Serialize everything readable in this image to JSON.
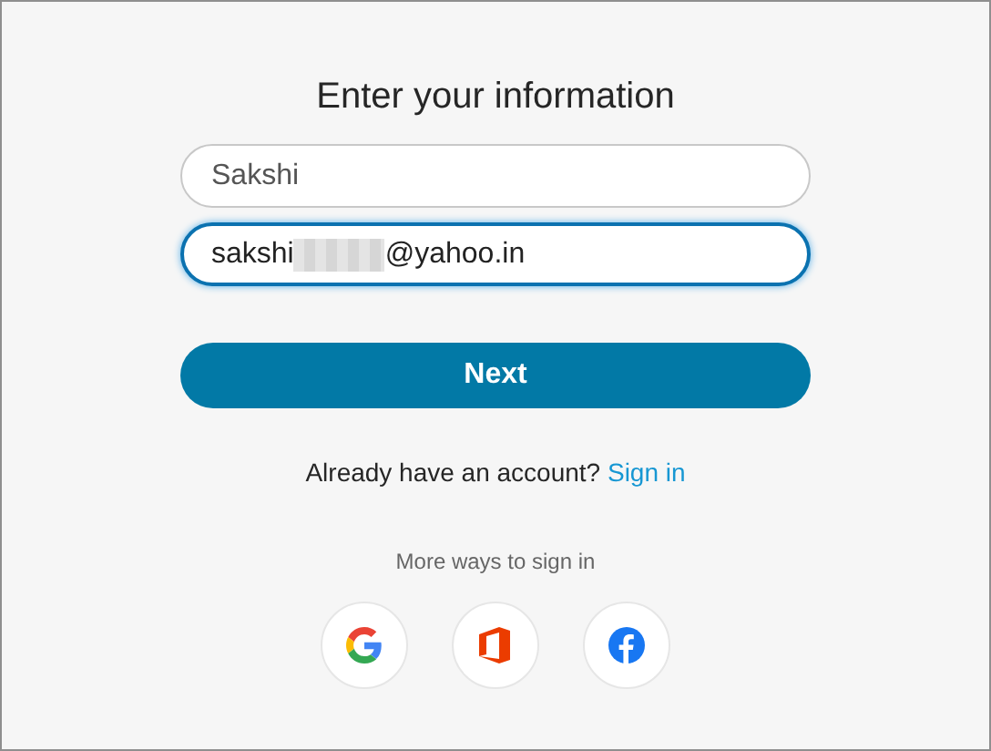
{
  "heading": "Enter your information",
  "fields": [
    {
      "value": [
        "Sakshi"
      ],
      "focused": false
    },
    {
      "value": [
        "sakshi",
        "@yahoo.in"
      ],
      "focused": true
    }
  ],
  "next_button": "Next",
  "signin_prompt": {
    "text": "Already have an account?",
    "link": "Sign in"
  },
  "more_ways": "More ways to sign in",
  "providers": [
    {
      "kind": "google"
    },
    {
      "kind": "office"
    },
    {
      "kind": "facebook"
    }
  ]
}
